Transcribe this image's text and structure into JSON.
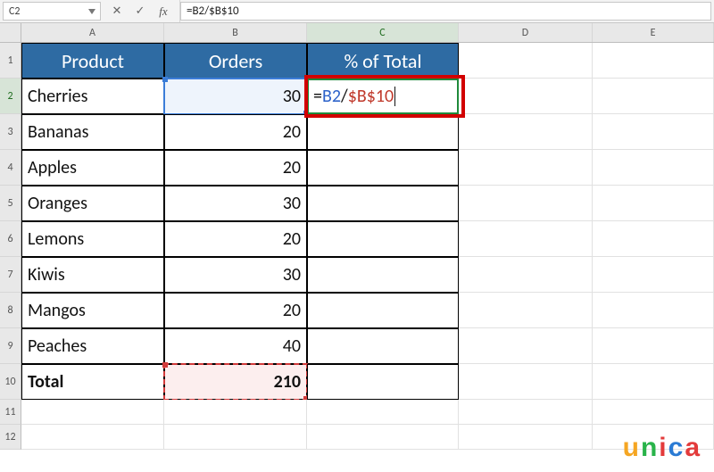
{
  "formula_bar": {
    "name_box": "C2",
    "cancel_glyph": "✕",
    "enter_glyph": "✓",
    "fx_label": "fx",
    "formula_text": "=B2/$B$10"
  },
  "columns": [
    "A",
    "B",
    "C",
    "D",
    "E"
  ],
  "row_numbers": [
    "1",
    "2",
    "3",
    "4",
    "5",
    "6",
    "7",
    "8",
    "9",
    "10",
    "11",
    "12"
  ],
  "headers": {
    "product": "Product",
    "orders": "Orders",
    "pct": "% of Total"
  },
  "rows": [
    {
      "product": "Cherries",
      "orders": "30"
    },
    {
      "product": "Bananas",
      "orders": "20"
    },
    {
      "product": "Apples",
      "orders": "20"
    },
    {
      "product": "Oranges",
      "orders": "30"
    },
    {
      "product": "Lemons",
      "orders": "20"
    },
    {
      "product": "Kiwis",
      "orders": "30"
    },
    {
      "product": "Mangos",
      "orders": "20"
    },
    {
      "product": "Peaches",
      "orders": "40"
    }
  ],
  "total": {
    "label": "Total",
    "value": "210"
  },
  "editing_cell": {
    "eq": "=",
    "ref1": "B2",
    "op": "/",
    "ref2": "$B$10"
  },
  "watermark": {
    "u": "u",
    "n": "n",
    "i": "i",
    "c": "c",
    "a": "a"
  },
  "chart_data": {
    "type": "table",
    "title": "",
    "columns": [
      "Product",
      "Orders",
      "% of Total"
    ],
    "rows": [
      [
        "Cherries",
        30,
        null
      ],
      [
        "Bananas",
        20,
        null
      ],
      [
        "Apples",
        20,
        null
      ],
      [
        "Oranges",
        30,
        null
      ],
      [
        "Lemons",
        20,
        null
      ],
      [
        "Kiwis",
        30,
        null
      ],
      [
        "Mangos",
        20,
        null
      ],
      [
        "Peaches",
        40,
        null
      ],
      [
        "Total",
        210,
        null
      ]
    ],
    "formula_in_C2": "=B2/$B$10"
  }
}
